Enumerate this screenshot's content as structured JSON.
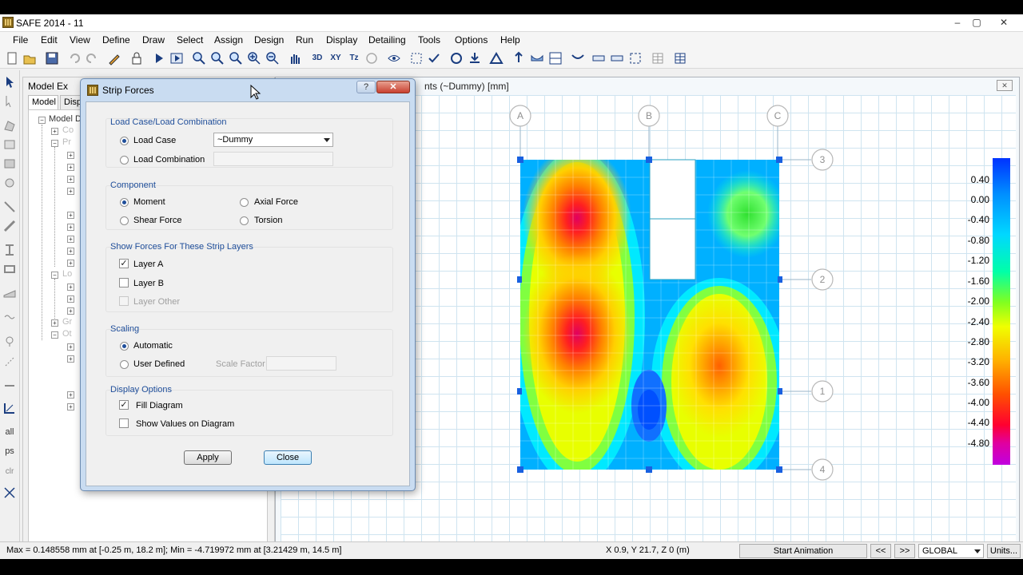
{
  "app": {
    "title": "SAFE 2014 - 11"
  },
  "window_buttons": {
    "minimize": "–",
    "restore": "▢",
    "close": "✕"
  },
  "menu": [
    "File",
    "Edit",
    "View",
    "Define",
    "Draw",
    "Select",
    "Assign",
    "Design",
    "Run",
    "Display",
    "Detailing",
    "Tools",
    "Options",
    "Help"
  ],
  "toolbar": {
    "view_3d": "3D",
    "view_xy": "XY",
    "view_tz": "Tz"
  },
  "explorer": {
    "title": "Model Ex",
    "tab_model": "Model",
    "tab_display": "Disp",
    "root": "Model D",
    "items": [
      "Co",
      "Pr",
      "Lo",
      "Gr",
      "Ot"
    ]
  },
  "left_toolbar": {
    "all": "all",
    "ps": "ps",
    "clr": "clr"
  },
  "plan": {
    "title": "nts (~Dummy)  [mm]",
    "close": "✕",
    "grid_x": [
      "A",
      "B",
      "C"
    ],
    "grid_y": [
      "3",
      "2",
      "1",
      "4"
    ]
  },
  "legend": {
    "values": [
      "0.40",
      "0.00",
      "-0.40",
      "-0.80",
      "-1.20",
      "-1.60",
      "-2.00",
      "-2.40",
      "-2.80",
      "-3.20",
      "-3.60",
      "-4.00",
      "-4.40",
      "-4.80"
    ]
  },
  "dialog": {
    "title": "Strip Forces",
    "help": "?",
    "close": "✕",
    "load": {
      "group_title": "Load Case/Load Combination",
      "load_case_label": "Load Case",
      "load_case_value": "~Dummy",
      "load_combination_label": "Load Combination",
      "selected": "Load Case"
    },
    "component": {
      "group_title": "Component",
      "moment": "Moment",
      "axial_force": "Axial Force",
      "shear_force": "Shear Force",
      "torsion": "Torsion",
      "selected": "Moment"
    },
    "layers": {
      "group_title": "Show Forces For These Strip Layers",
      "layer_a": "Layer A",
      "layer_b": "Layer B",
      "layer_other": "Layer Other",
      "layer_a_checked": true,
      "layer_b_checked": false
    },
    "scaling": {
      "group_title": "Scaling",
      "automatic": "Automatic",
      "user_defined": "User Defined",
      "scale_factor": "Scale Factor",
      "selected": "Automatic"
    },
    "display": {
      "group_title": "Display Options",
      "fill_diagram": "Fill Diagram",
      "show_values": "Show Values on Diagram",
      "fill_checked": true,
      "values_checked": false
    },
    "apply": "Apply",
    "close_button": "Close"
  },
  "status": {
    "extremes": "Max = 0.148558 mm at [-0.25 m, 18.2 m];  Min = -4.719972 mm at [3.21429 m, 14.5 m]",
    "coords": "X 0.9,  Y 21.7,  Z 0  (m)",
    "start_animation": "Start Animation",
    "prev": "<<",
    "next": ">>",
    "coord_system": "GLOBAL",
    "units": "Units..."
  },
  "colors": {
    "dialog_border": "#6d8bb0",
    "group_title": "#1f4e9a",
    "grid": "#cfe4f0"
  }
}
